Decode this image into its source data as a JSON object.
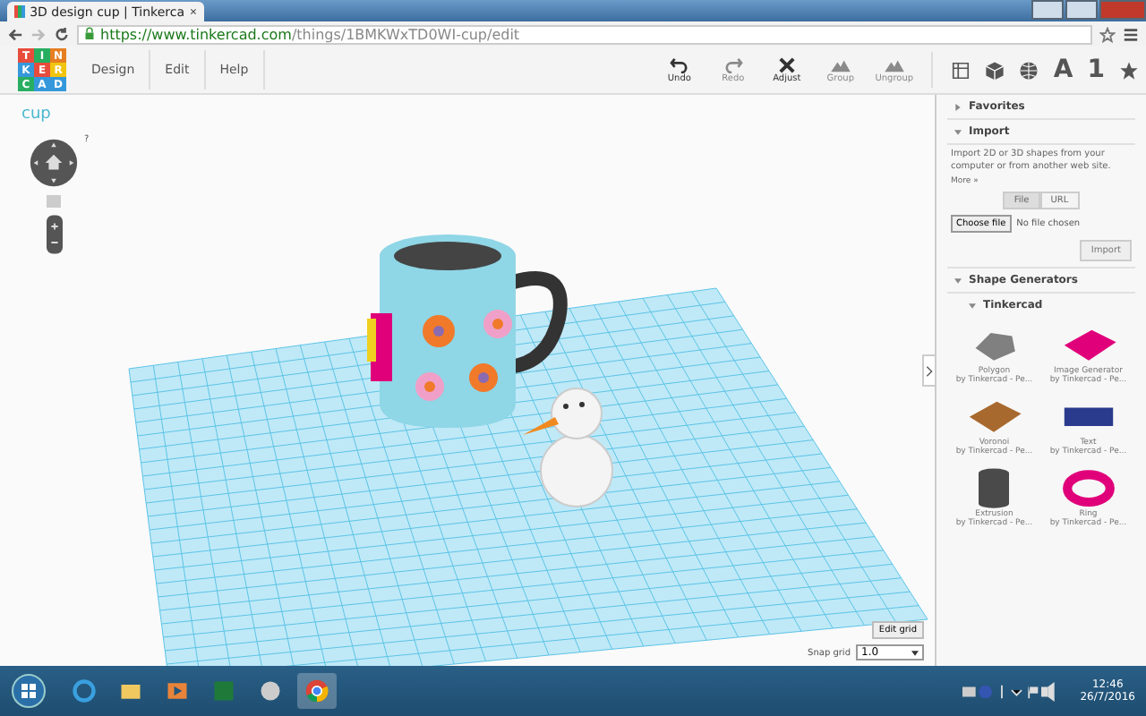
{
  "browser": {
    "tab_title": "3D design cup | Tinkerca",
    "url_host": "https://www.tinkercad.com",
    "url_path": "/things/1BMKWxTD0WI-cup/edit"
  },
  "logo": {
    "letters": [
      "T",
      "I",
      "N",
      "K",
      "E",
      "R",
      "C",
      "A",
      "D"
    ]
  },
  "menu": [
    "Design",
    "Edit",
    "Help"
  ],
  "tools": [
    {
      "kind": "undo",
      "label": "Undo",
      "disabled": false
    },
    {
      "kind": "redo",
      "label": "Redo",
      "disabled": true
    },
    {
      "kind": "adjust",
      "label": "Adjust",
      "disabled": false
    },
    {
      "kind": "group",
      "label": "Group",
      "disabled": true
    },
    {
      "kind": "ungroup",
      "label": "Ungroup",
      "disabled": true
    }
  ],
  "view_icons": [
    {
      "kind": "workplane"
    },
    {
      "kind": "box"
    },
    {
      "kind": "sphere"
    },
    {
      "kind": "text",
      "label": "A"
    },
    {
      "kind": "text",
      "label": "1"
    },
    {
      "kind": "star"
    }
  ],
  "canvas": {
    "title": "cup",
    "help": "?",
    "edit_grid": "Edit grid",
    "snap_label": "Snap grid",
    "snap_value": "1.0"
  },
  "panel": {
    "favorites": {
      "label": "Favorites",
      "expanded": false
    },
    "import": {
      "label": "Import",
      "expanded": true,
      "description": "Import 2D or 3D shapes from your computer or from another web site.",
      "more": "More »",
      "tabs": [
        {
          "label": "File",
          "selected": true
        },
        {
          "label": "URL",
          "selected": false
        }
      ],
      "choose_file": "Choose file",
      "no_file": "No file chosen",
      "import_button": "Import"
    },
    "shape_generators": {
      "label": "Shape Generators",
      "expanded": true
    },
    "section": {
      "label": "Tinkercad",
      "expanded": true
    },
    "shapes": [
      {
        "kind": "polygon",
        "name": "Polygon",
        "author": "by Tinkercad - Pe...",
        "color": "#808080"
      },
      {
        "kind": "slab",
        "name": "Image Generator",
        "author": "by Tinkercad - Pe...",
        "color": "#e0007a"
      },
      {
        "kind": "slab",
        "name": "Voronoi",
        "author": "by Tinkercad - Pe...",
        "color": "#a8692e"
      },
      {
        "kind": "text",
        "name": "Text",
        "author": "by Tinkercad - Pe...",
        "color": "#2a3a8c"
      },
      {
        "kind": "cylinder",
        "name": "Extrusion",
        "author": "by Tinkercad - Pe...",
        "color": "#4a4a4a"
      },
      {
        "kind": "ring",
        "name": "Ring",
        "author": "by Tinkercad - Pe...",
        "color": "#e0007a"
      }
    ]
  },
  "taskbar": {
    "apps": [
      {
        "kind": "ie"
      },
      {
        "kind": "folder"
      },
      {
        "kind": "media"
      },
      {
        "kind": "excel"
      },
      {
        "kind": "paint"
      },
      {
        "kind": "chrome"
      }
    ],
    "time": "12:46",
    "date": "26/7/2016"
  }
}
